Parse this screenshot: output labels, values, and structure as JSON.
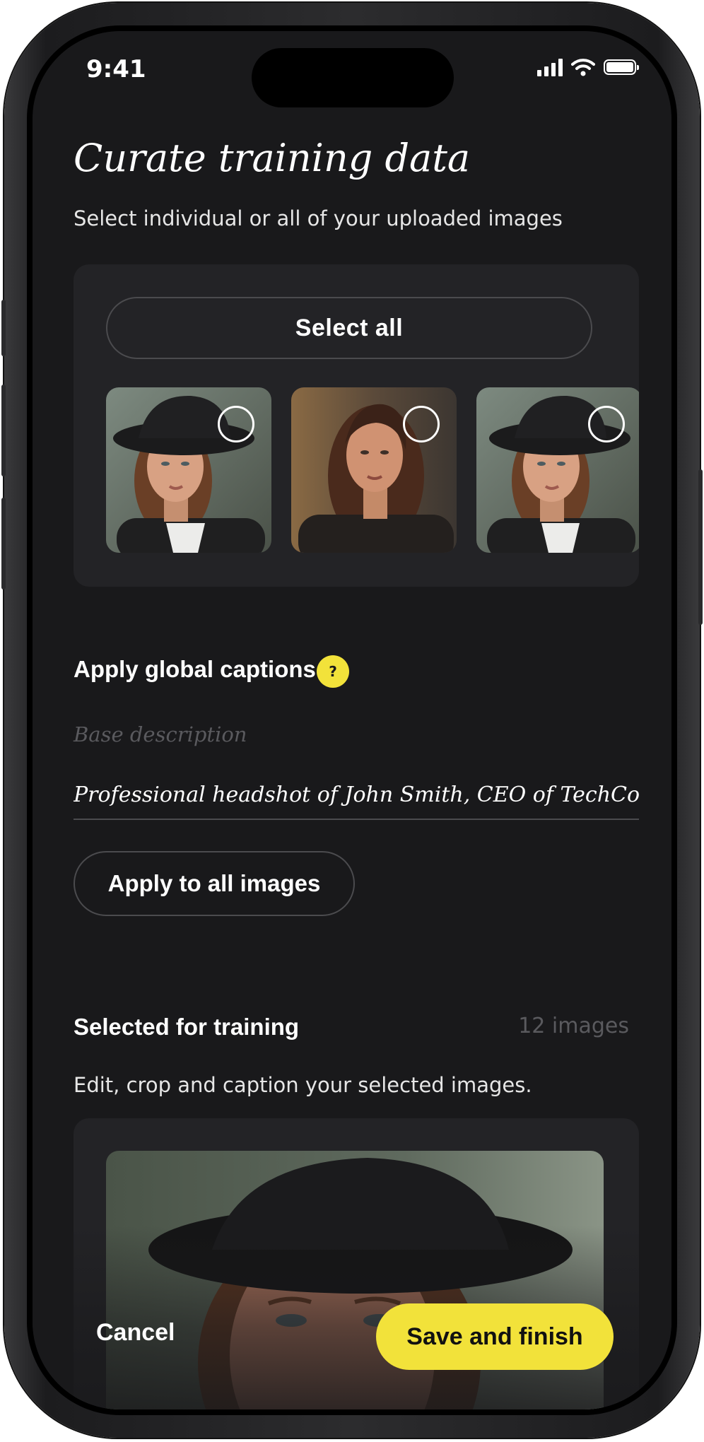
{
  "status_bar": {
    "time": "9:41",
    "signal_icon": "cellular-signal-icon",
    "wifi_icon": "wifi-icon",
    "battery_icon": "battery-icon"
  },
  "header": {
    "title": "Curate training data",
    "subtitle": "Select individual or all of your uploaded images"
  },
  "gallery": {
    "select_all_label": "Select all",
    "thumbnails": [
      {
        "subject": "woman in black hat",
        "selected": false
      },
      {
        "subject": "woman with long wavy hair",
        "selected": false
      },
      {
        "subject": "woman in black hat",
        "selected": false
      }
    ]
  },
  "captions": {
    "heading": "Apply global captions",
    "help_label": "?",
    "field_label": "Base description",
    "field_value": "Professional headshot of John Smith, CEO of TechCo",
    "apply_label": "Apply to all images"
  },
  "selected": {
    "heading": "Selected for training",
    "count": "12 images",
    "description": "Edit, crop and caption your selected images."
  },
  "footer": {
    "cancel_label": "Cancel",
    "save_label": "Save and finish"
  },
  "colors": {
    "background": "#19191b",
    "card": "#232326",
    "accent": "#f2e23a",
    "muted_text": "#5a5a5e"
  }
}
